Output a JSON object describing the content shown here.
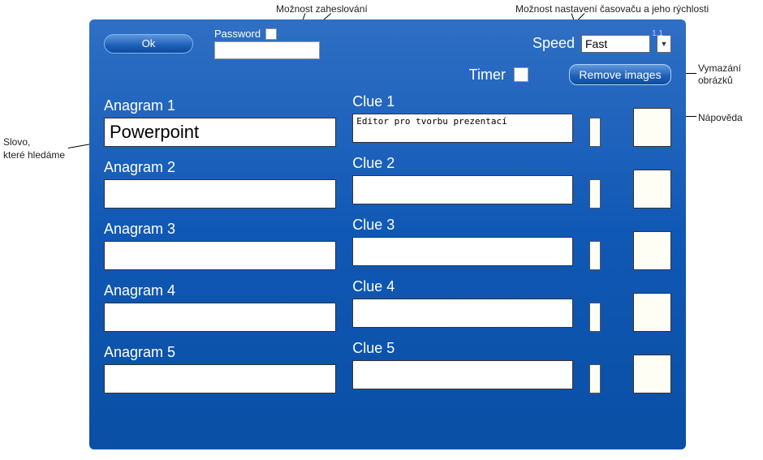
{
  "header": {
    "ok_label": "Ok",
    "password_label": "Password",
    "speed_label": "Speed",
    "speed_value": "Fast",
    "version": "1.1",
    "timer_label": "Timer",
    "remove_images_label": "Remove images"
  },
  "rows": [
    {
      "anagram_label": "Anagram 1",
      "anagram_value": "Powerpoint",
      "clue_label": "Clue 1",
      "clue_value": "Editor pro tvorbu prezentací"
    },
    {
      "anagram_label": "Anagram 2",
      "anagram_value": "",
      "clue_label": "Clue 2",
      "clue_value": ""
    },
    {
      "anagram_label": "Anagram 3",
      "anagram_value": "",
      "clue_label": "Clue 3",
      "clue_value": ""
    },
    {
      "anagram_label": "Anagram 4",
      "anagram_value": "",
      "clue_label": "Clue 4",
      "clue_value": ""
    },
    {
      "anagram_label": "Anagram 5",
      "anagram_value": "",
      "clue_label": "Clue 5",
      "clue_value": ""
    }
  ],
  "annotations": {
    "password_hint": "Možnost zaheslování",
    "timer_hint": "Možnost nastavení časovaču a jeho rýchlosti",
    "remove_hint_l1": "Vymazání",
    "remove_hint_l2": "obrázků",
    "help_hint": "Nápověda",
    "word_hint_l1": "Slovo,",
    "word_hint_l2": "které hledáme"
  }
}
